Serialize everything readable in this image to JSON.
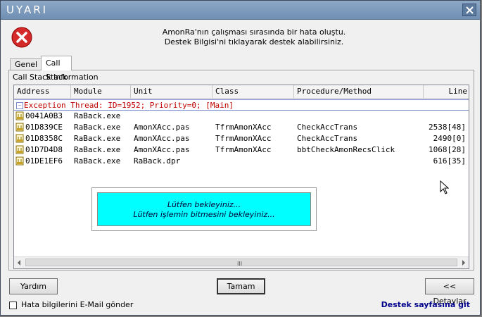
{
  "window": {
    "title": "UYARI"
  },
  "message": {
    "line1": "AmonRa'nın çalışması sırasında bir hata oluştu.",
    "line2": "Destek Bilgisi'ni tıklayarak destek alabilirsiniz."
  },
  "tabs": [
    {
      "label": "Genel"
    },
    {
      "label": "Call Stack"
    }
  ],
  "panel": {
    "title": "Call Stack Information"
  },
  "grid": {
    "columns": [
      "Address",
      "Module",
      "Unit",
      "Class",
      "Procedure/Method",
      "Line"
    ],
    "exception": "Exception Thread: ID=1952; Priority=0; [Main]",
    "rows": [
      {
        "address": "0041A0B3",
        "module": "RaBack.exe",
        "unit": "",
        "cls": "",
        "proc": "",
        "line": ""
      },
      {
        "address": "01D839CE",
        "module": "RaBack.exe",
        "unit": "AmonXAcc.pas",
        "cls": "TfrmAmonXAcc",
        "proc": "CheckAccTrans",
        "line": "2538[48]"
      },
      {
        "address": "01D8358C",
        "module": "RaBack.exe",
        "unit": "AmonXAcc.pas",
        "cls": "TfrmAmonXAcc",
        "proc": "CheckAccTrans",
        "line": "2490[0]"
      },
      {
        "address": "01D7D4D8",
        "module": "RaBack.exe",
        "unit": "AmonXAcc.pas",
        "cls": "TfrmAmonXAcc",
        "proc": "bbtCheckAmonRecsClick",
        "line": "1068[28]"
      },
      {
        "address": "01DE1EF6",
        "module": "RaBack.exe",
        "unit": "RaBack.dpr",
        "cls": "",
        "proc": "",
        "line": "616[35]"
      }
    ],
    "scroll_grip": "III"
  },
  "wait": {
    "line1": "Lütfen bekleyiniz...",
    "line2": "Lütfen işlemin bitmesini bekleyiniz..."
  },
  "buttons": {
    "help": "Yardım",
    "ok": "Tamam",
    "details": "<< Detaylar"
  },
  "email_checkbox": {
    "label": "Hata bilgilerini E-Mail gönder",
    "checked": false
  },
  "support_link": "Destek sayfasına git",
  "colors": {
    "exception_text": "#c00000",
    "wait_bg": "#00ffff",
    "link": "#00008b"
  }
}
